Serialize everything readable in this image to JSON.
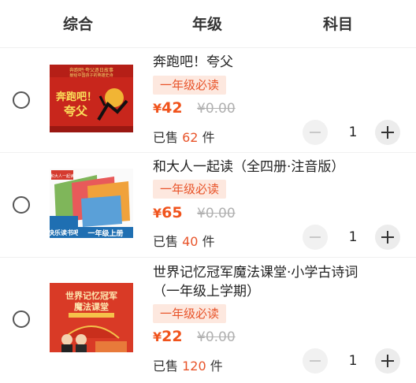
{
  "tabs": [
    {
      "label": "综合"
    },
    {
      "label": "年级"
    },
    {
      "label": "科目"
    }
  ],
  "products": [
    {
      "title": "奔跑吧！夸父",
      "grade": "一年级必读",
      "currency": "¥",
      "price": "42",
      "original_price": "¥0.00",
      "sold_prefix": "已售",
      "sold_count": "62",
      "sold_unit": "件",
      "quantity": "1",
      "cover": {
        "line1": "奔跑吧！",
        "line2": "夸父",
        "top_text": "奔跑吧·夸父逐日故事",
        "sub_text": "献给中国孩子的英雄史诗"
      }
    },
    {
      "title": "和大人一起读（全四册·注音版）",
      "grade": "一年级必读",
      "currency": "¥",
      "price": "65",
      "original_price": "¥0.00",
      "sold_prefix": "已售",
      "sold_count": "40",
      "sold_unit": "件",
      "quantity": "1",
      "cover": {
        "badge": "快乐读书吧",
        "strip": "一年级上册",
        "tag": "和大人一起读"
      }
    },
    {
      "title_line1": "世界记忆冠军魔法课堂·小学古诗词",
      "title_line2": "（一年级上学期）",
      "grade": "一年级必读",
      "currency": "¥",
      "price": "22",
      "original_price": "¥0.00",
      "sold_prefix": "已售",
      "sold_count": "120",
      "sold_unit": "件",
      "quantity": "1",
      "cover": {
        "line1": "世界记忆冠军",
        "line2": "魔法课堂"
      }
    }
  ],
  "colors": {
    "accent": "#f0531c",
    "badge_bg": "#fde8df",
    "strike": "#b0b0b0"
  }
}
